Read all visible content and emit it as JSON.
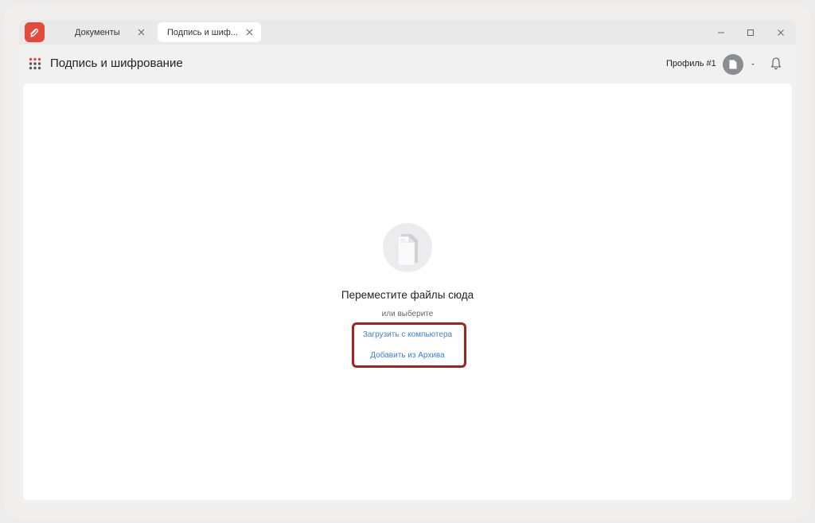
{
  "tabs": [
    {
      "label": "Документы",
      "active": false
    },
    {
      "label": "Подпись и шиф...",
      "active": true
    }
  ],
  "header": {
    "title": "Подпись и шифрование",
    "profile_label": "Профиль #1"
  },
  "dropzone": {
    "title": "Переместите файлы сюда",
    "subtitle": "или выберите",
    "upload_link": "Загрузить с компьютера",
    "archive_link": "Добавить из Архива"
  },
  "icons": {
    "app_logo": "app-logo-icon",
    "apps_grid": "apps-grid-icon",
    "tab_close": "close-icon",
    "minimize": "minimize-icon",
    "maximize": "maximize-icon",
    "close": "close-icon",
    "avatar": "document-icon",
    "caret": "chevron-down-icon",
    "bell": "bell-icon",
    "drop": "files-icon"
  },
  "colors": {
    "brand": "#e34a3a",
    "link": "#3b7fd9",
    "highlight": "#a2231c"
  }
}
